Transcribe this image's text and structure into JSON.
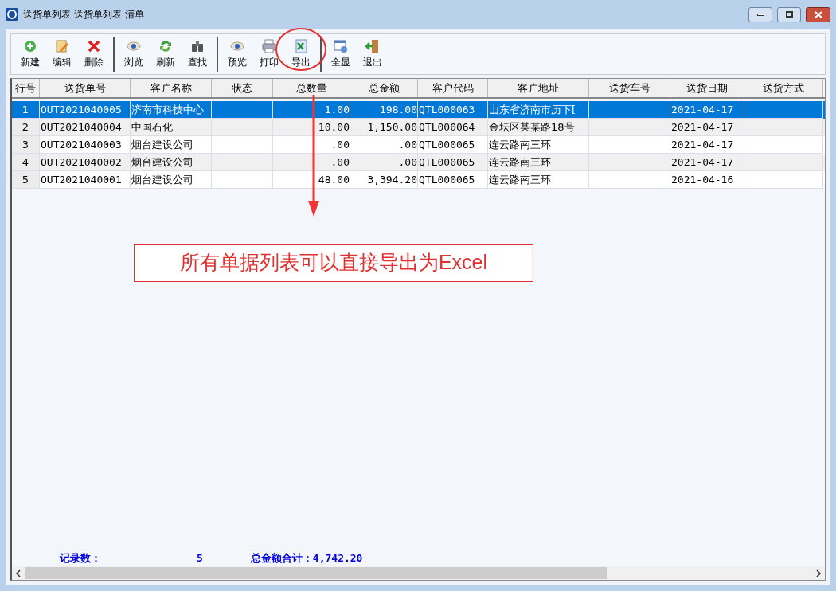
{
  "window": {
    "title": "送货单列表 送货单列表 清单"
  },
  "toolbar": [
    [
      "新建",
      "编辑",
      "删除"
    ],
    [
      "浏览",
      "刷新",
      "查找"
    ],
    [
      "预览",
      "打印",
      "导出"
    ],
    [
      "全显",
      "退出"
    ]
  ],
  "table": {
    "columns": [
      "行号",
      "送货单号",
      "客户名称",
      "状态",
      "总数量",
      "总金额",
      "客户代码",
      "客户地址",
      "送货车号",
      "送货日期",
      "送货方式"
    ],
    "rows": [
      {
        "selected": true,
        "cells": [
          "1",
          "OUT2021040005",
          "济南市科技中心",
          "",
          "1.00",
          "198.00",
          "QTL000063",
          "山东省济南市历下[",
          "",
          "2021-04-17",
          ""
        ]
      },
      {
        "selected": false,
        "cells": [
          "2",
          "OUT2021040004",
          "中国石化",
          "",
          "10.00",
          "1,150.00",
          "QTL000064",
          "金坛区某某路18号",
          "",
          "2021-04-17",
          ""
        ]
      },
      {
        "selected": false,
        "cells": [
          "3",
          "OUT2021040003",
          "烟台建设公司",
          "",
          ".00",
          ".00",
          "QTL000065",
          "连云路南三环",
          "",
          "2021-04-17",
          ""
        ]
      },
      {
        "selected": false,
        "cells": [
          "4",
          "OUT2021040002",
          "烟台建设公司",
          "",
          ".00",
          ".00",
          "QTL000065",
          "连云路南三环",
          "",
          "2021-04-17",
          ""
        ]
      },
      {
        "selected": false,
        "cells": [
          "5",
          "OUT2021040001",
          "烟台建设公司",
          "",
          "48.00",
          "3,394.20",
          "QTL000065",
          "连云路南三环",
          "",
          "2021-04-16",
          ""
        ]
      }
    ]
  },
  "footer": {
    "count_label": "记录数：",
    "count": "5",
    "total_label": "总金额合计：",
    "total": "4,742.20"
  },
  "annotation": {
    "text": "所有单据列表可以直接导出为Excel"
  }
}
